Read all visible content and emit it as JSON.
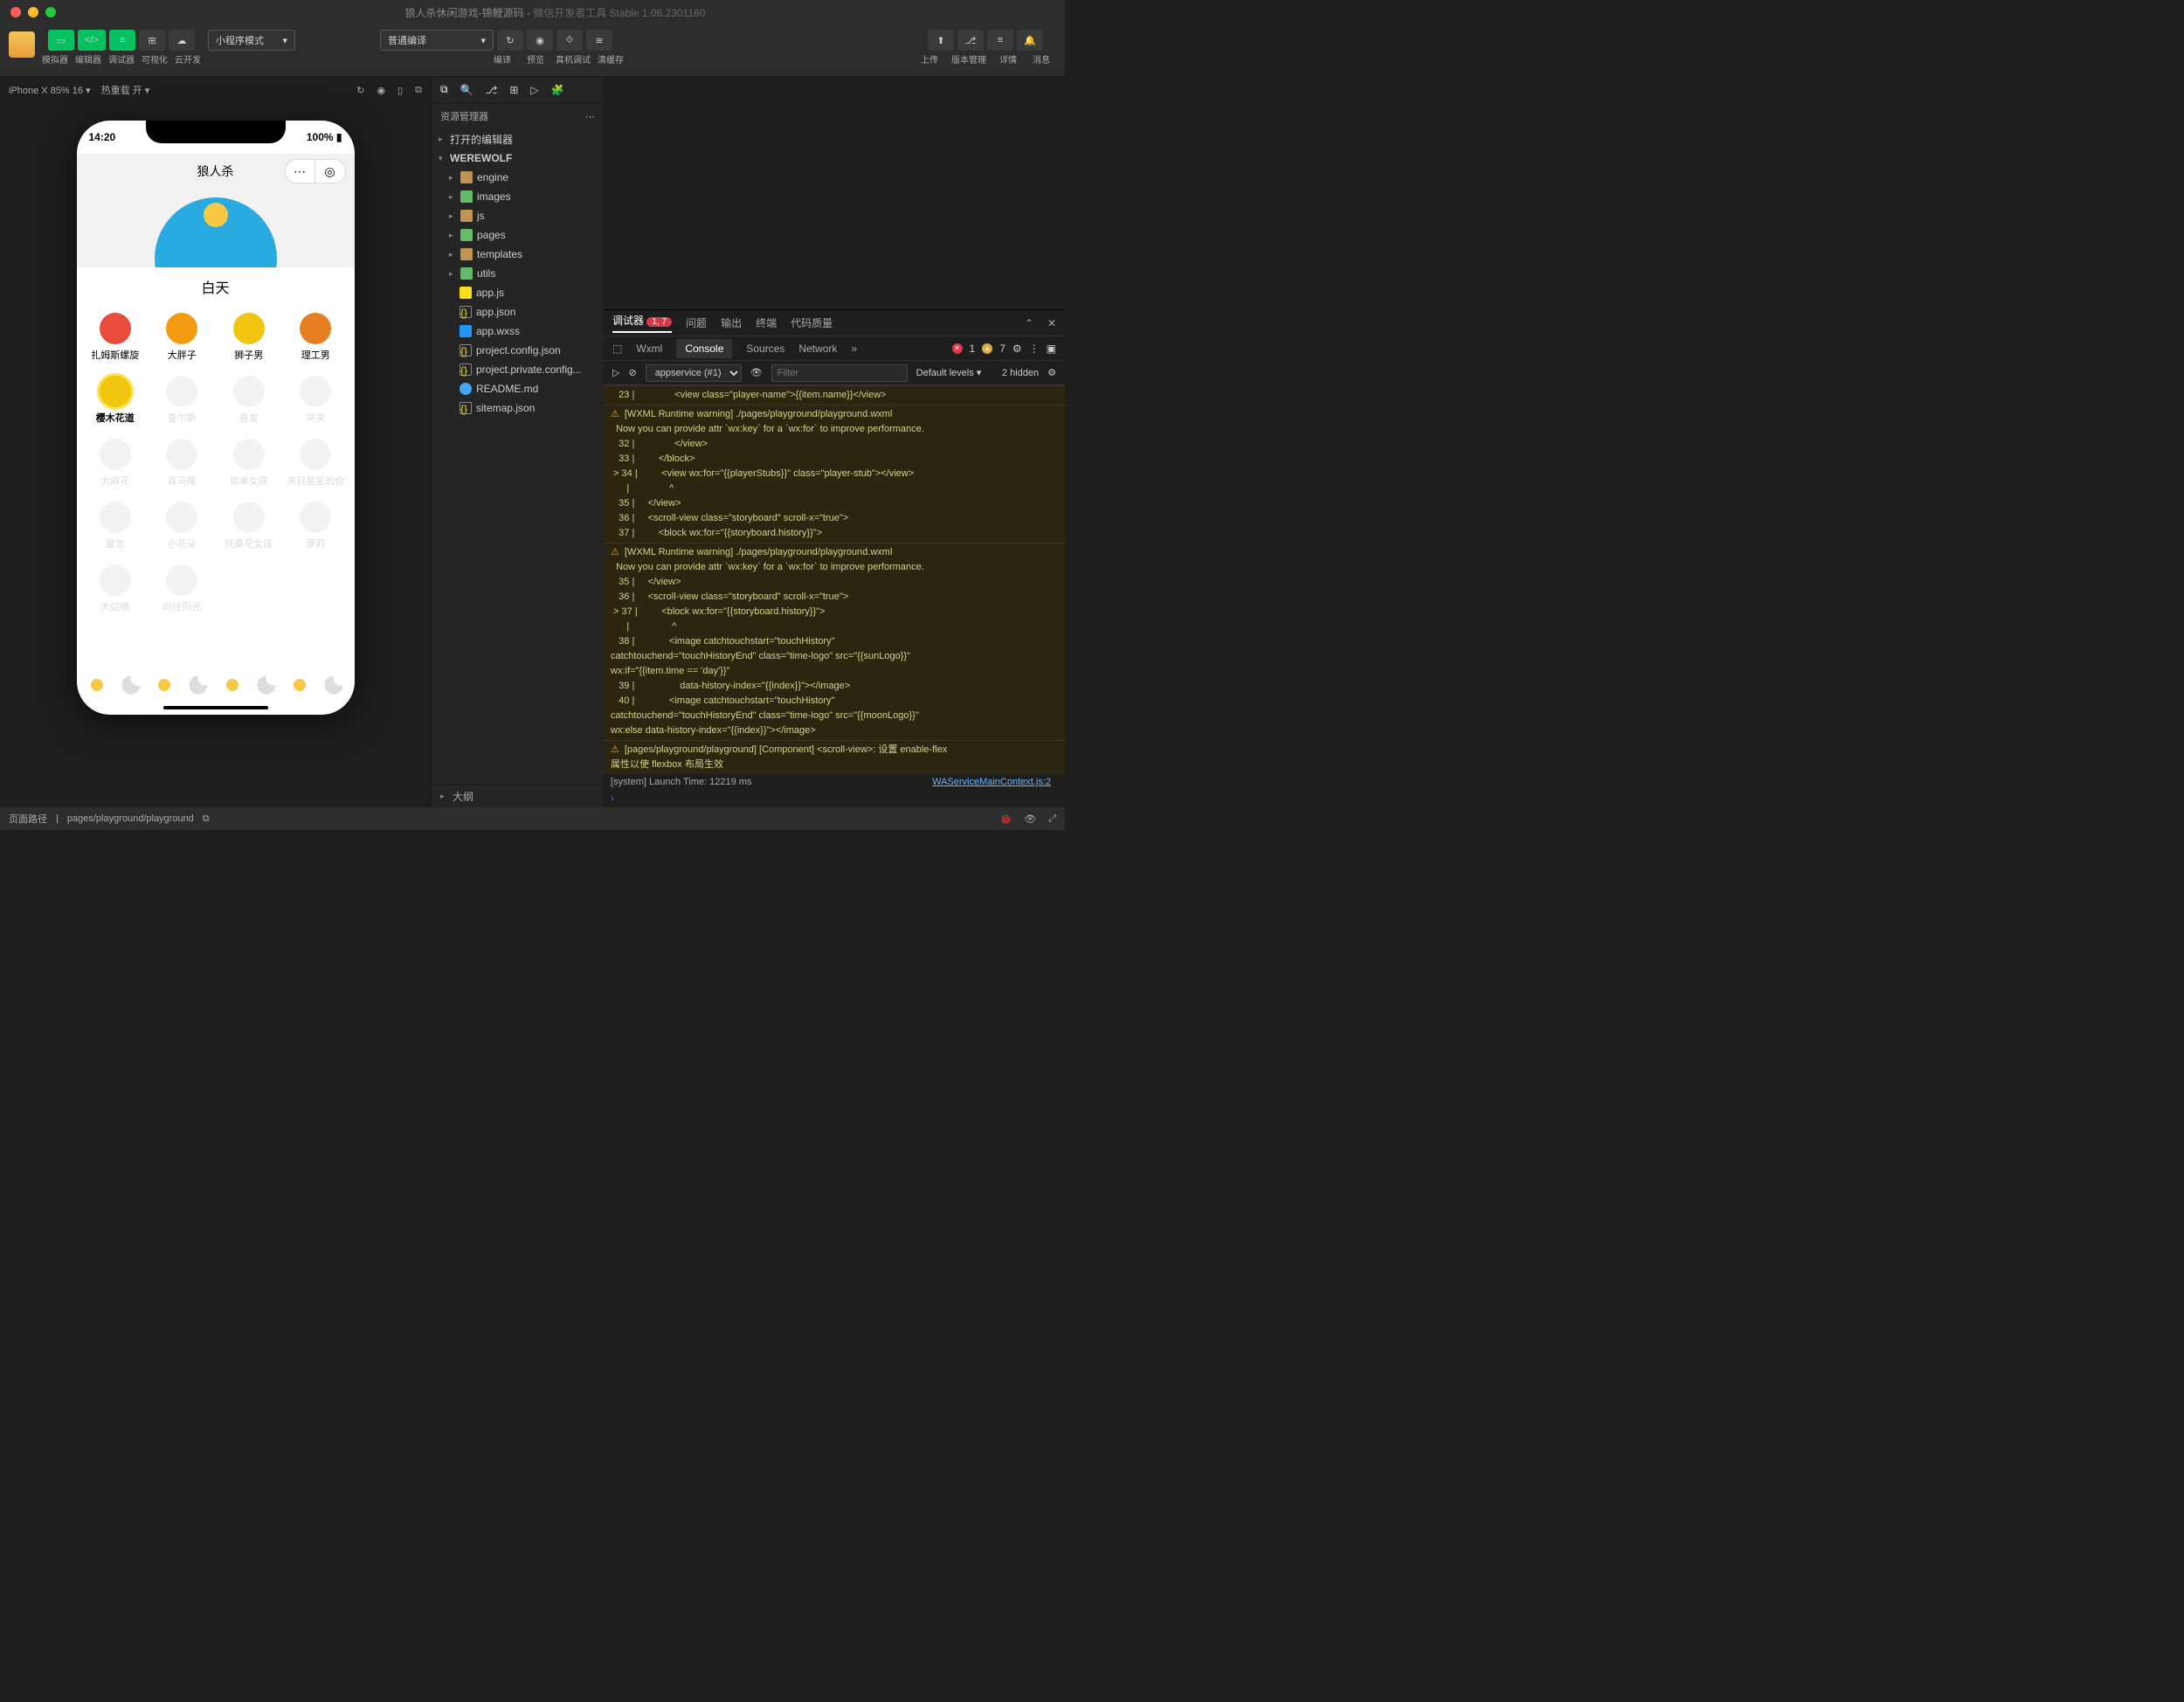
{
  "window": {
    "title": "狼人杀休闲游戏-锦鲤源码",
    "subtitle": "微信开发者工具 Stable 1.06.2301160"
  },
  "toolbar": {
    "modes": [
      "模拟器",
      "编辑器",
      "调试器",
      "可视化",
      "云开发"
    ],
    "mode_select": "小程序模式",
    "compile_select": "普通编译",
    "compile_actions": [
      "编译",
      "预览",
      "真机调试",
      "清缓存"
    ],
    "right_actions": [
      "上传",
      "版本管理",
      "详情",
      "消息"
    ]
  },
  "simulator": {
    "device": "iPhone X 85% 16",
    "hotreload": "热重载 开",
    "time": "14:20",
    "battery": "100%",
    "app_title": "狼人杀",
    "phase": "白天",
    "players_row1": [
      "扎姆斯螺旋",
      "大胖子",
      "狮子男",
      "理工男"
    ],
    "players_row2": [
      "樱木花道",
      "查尔斯",
      "卷发",
      "突突"
    ],
    "players_row3": [
      "大麻花",
      "双马尾",
      "简单女孩",
      "来自星星的你"
    ],
    "players_row4": [
      "童言",
      "小花朵",
      "扶桑花女孩",
      "萝莉"
    ],
    "players_row5": [
      "大姑娘",
      "向往阳光",
      "",
      ""
    ]
  },
  "explorer": {
    "title": "资源管理器",
    "opened": "打开的编辑器",
    "root": "WEREWOLF",
    "folders": [
      "engine",
      "images",
      "js",
      "pages",
      "templates",
      "utils"
    ],
    "files": [
      "app.js",
      "app.json",
      "app.wxss",
      "project.config.json",
      "project.private.config...",
      "README.md",
      "sitemap.json"
    ],
    "outline": "大纲"
  },
  "debugger": {
    "tabs": [
      "调试器",
      "问题",
      "输出",
      "终端",
      "代码质量"
    ],
    "badge": "1, 7",
    "devtabs": [
      "Wxml",
      "Console",
      "Sources",
      "Network"
    ],
    "active_devtab": "Console",
    "errcount": "1",
    "warncount": "7",
    "context": "appservice (#1)",
    "filter_placeholder": "Filter",
    "levels": "Default levels",
    "hidden": "2 hidden",
    "launch": "[system] Launch Time: 12219 ms",
    "link": "WAServiceMainContext.js:2"
  },
  "console_lines": [
    "   23 |               <view class=\"player-name\">{{item.name}}</view>",
    "[WXML Runtime warning] ./pages/playground/playground.wxml",
    "  Now you can provide attr `wx:key` for a `wx:for` to improve performance.",
    "   32 |               </view>",
    "   33 |         </block>",
    " > 34 |         <view wx:for=\"{{playerStubs}}\" class=\"player-stub\"></view>",
    "      |               ^",
    "   35 |     </view>",
    "   36 |     <scroll-view class=\"storyboard\" scroll-x=\"true\">",
    "   37 |         <block wx:for=\"{{storyboard.history}}\">",
    "[WXML Runtime warning] ./pages/playground/playground.wxml",
    "  Now you can provide attr `wx:key` for a `wx:for` to improve performance.",
    "   35 |     </view>",
    "   36 |     <scroll-view class=\"storyboard\" scroll-x=\"true\">",
    " > 37 |         <block wx:for=\"{{storyboard.history}}\">",
    "      |                ^",
    "   38 |             <image catchtouchstart=\"touchHistory\"",
    "catchtouchend=\"touchHistoryEnd\" class=\"time-logo\" src=\"{{sunLogo}}\"",
    "wx:if=\"{{item.time == 'day'}}\"",
    "   39 |                 data-history-index=\"{{index}}\"></image>",
    "   40 |             <image catchtouchstart=\"touchHistory\"",
    "catchtouchend=\"touchHistoryEnd\" class=\"time-logo\" src=\"{{moonLogo}}\"",
    "wx:else data-history-index=\"{{index}}\"></image>",
    "[pages/playground/playground] [Component] <scroll-view>: 设置 enable-flex",
    "属性以使 flexbox 布局生效"
  ],
  "footer": {
    "path_label": "页面路径",
    "path": "pages/playground/playground"
  }
}
